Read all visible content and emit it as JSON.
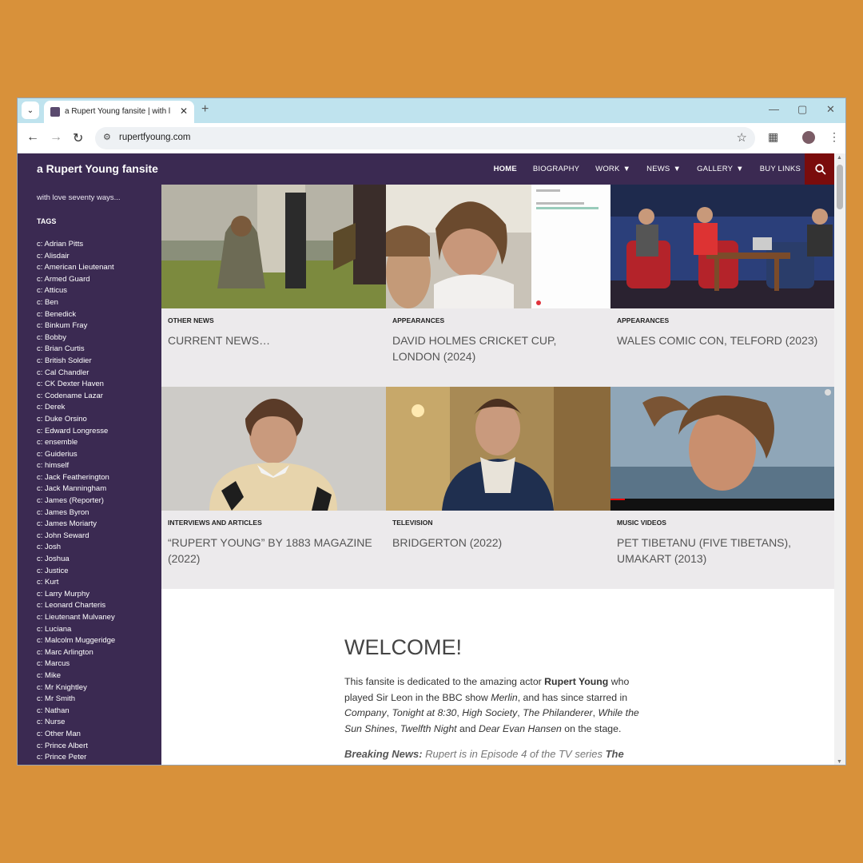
{
  "browser": {
    "tab_title": "a Rupert Young fansite | with lo",
    "url": "rupertfyoung.com"
  },
  "site": {
    "title": "a Rupert Young fansite",
    "tagline": "with love seventy ways...",
    "nav": [
      {
        "label": "HOME",
        "active": true,
        "dropdown": false
      },
      {
        "label": "BIOGRAPHY",
        "active": false,
        "dropdown": false
      },
      {
        "label": "WORK",
        "active": false,
        "dropdown": true
      },
      {
        "label": "NEWS",
        "active": false,
        "dropdown": true
      },
      {
        "label": "GALLERY",
        "active": false,
        "dropdown": true
      },
      {
        "label": "BUY LINKS",
        "active": false,
        "dropdown": false
      }
    ],
    "accent_color": "#7a0c0c",
    "header_color": "#3b2a52"
  },
  "sidebar": {
    "tags_heading": "TAGS",
    "tags": [
      "c: Adrian Pitts",
      "c: Alisdair",
      "c: American Lieutenant",
      "c: Armed Guard",
      "c: Atticus",
      "c: Ben",
      "c: Benedick",
      "c: Binkum Fray",
      "c: Bobby",
      "c: Brian Curtis",
      "c: British Soldier",
      "c: Cal Chandler",
      "c: CK Dexter Haven",
      "c: Codename Lazar",
      "c: Derek",
      "c: Duke Orsino",
      "c: Edward Longresse",
      "c: ensemble",
      "c: Guiderius",
      "c: himself",
      "c: Jack Featherington",
      "c: Jack Manningham",
      "c: James (Reporter)",
      "c: James Byron",
      "c: James Moriarty",
      "c: John Seward",
      "c: Josh",
      "c: Joshua",
      "c: Justice",
      "c: Kurt",
      "c: Larry Murphy",
      "c: Leonard Charteris",
      "c: Lieutenant Mulvaney",
      "c: Luciana",
      "c: Malcolm Muggeridge",
      "c: Marc Arlington",
      "c: Marcus",
      "c: Mike",
      "c: Mr Knightley",
      "c: Mr Smith",
      "c: Nathan",
      "c: Nurse",
      "c: Other Man",
      "c: Prince Albert",
      "c: Prince Peter"
    ]
  },
  "posts": [
    {
      "category": "OTHER NEWS",
      "title": "CURRENT NEWS…"
    },
    {
      "category": "APPEARANCES",
      "title": "DAVID HOLMES CRICKET CUP, LONDON (2024)"
    },
    {
      "category": "APPEARANCES",
      "title": "WALES COMIC CON, TELFORD (2023)"
    },
    {
      "category": "INTERVIEWS AND ARTICLES",
      "title": "“RUPERT YOUNG” BY 1883 MAGAZINE (2022)"
    },
    {
      "category": "TELEVISION",
      "title": "BRIDGERTON (2022)"
    },
    {
      "category": "MUSIC VIDEOS",
      "title": "PET TIBETANU (FIVE TIBETANS), UMAKART (2013)"
    }
  ],
  "welcome": {
    "heading": "WELCOME!",
    "p1_a": "This fansite is dedicated to the amazing actor ",
    "p1_name": "Rupert Young",
    "p1_b": " who played Sir Leon in the BBC show ",
    "p1_show": "Merlin",
    "p1_c": ", and has since starred in ",
    "p1_plays": [
      "Company",
      "Tonight at 8:30",
      "High Society",
      "The Philanderer",
      "While the Sun Shines",
      "Twelfth Night",
      "Dear Evan Hansen"
    ],
    "p1_d": " on the stage.",
    "breaking_label": "Breaking News:",
    "breaking_text": " Rupert is in Episode 4 of the TV series ",
    "breaking_show": "The"
  }
}
